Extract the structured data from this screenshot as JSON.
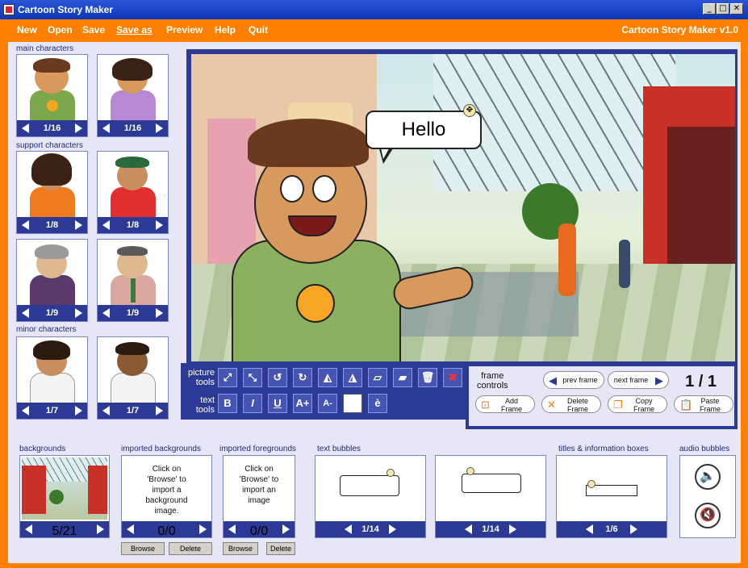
{
  "window": {
    "title": "Cartoon Story Maker"
  },
  "menu": {
    "items": [
      "New",
      "Open",
      "Save",
      "Save as",
      "Preview",
      "Help",
      "Quit"
    ],
    "active": "Save as",
    "version": "Cartoon Story Maker v1.0"
  },
  "characters": {
    "main_label": "main characters",
    "support_label": "support characters",
    "minor_label": "minor characters",
    "main": [
      {
        "count": "1/16"
      },
      {
        "count": "1/16"
      }
    ],
    "support": [
      {
        "count": "1/8"
      },
      {
        "count": "1/8"
      },
      {
        "count": "1/9"
      },
      {
        "count": "1/9"
      }
    ],
    "minor": [
      {
        "count": "1/7"
      },
      {
        "count": "1/7"
      }
    ]
  },
  "scene": {
    "speech_text": "Hello"
  },
  "tools": {
    "picture_label_1": "picture",
    "picture_label_2": "tools",
    "text_label_1": "text",
    "text_label_2": "tools",
    "bold": "B",
    "italic": "I",
    "underline": "U",
    "size_up": "A+",
    "size_down": "A-",
    "accent": "è"
  },
  "frame_controls": {
    "label_1": "frame",
    "label_2": "controls",
    "prev": "prev frame",
    "next": "next frame",
    "counter": "1 / 1",
    "add_1": "Add",
    "add_2": "Frame",
    "delete_1": "Delete",
    "delete_2": "Frame",
    "copy_1": "Copy",
    "copy_2": "Frame",
    "paste_1": "Paste",
    "paste_2": "Frame"
  },
  "bottom": {
    "backgrounds_label": "backgrounds",
    "backgrounds_count": "5/21",
    "imported_bg_label": "imported backgrounds",
    "imported_bg_text_1": "Click on",
    "imported_bg_text_2": "'Browse' to",
    "imported_bg_text_3": "import a",
    "imported_bg_text_4": "background",
    "imported_bg_text_5": "image.",
    "imported_bg_count": "0/0",
    "imported_fg_label": "imported foregrounds",
    "imported_fg_text_1": "Click on",
    "imported_fg_text_2": "'Browse' to",
    "imported_fg_text_3": "import an",
    "imported_fg_text_4": "image",
    "imported_fg_count": "0/0",
    "browse": "Browse",
    "delete": "Delete",
    "text_bubbles_label": "text bubbles",
    "bubble1_count": "1/14",
    "bubble2_count": "1/14",
    "titles_label": "titles & information boxes",
    "titles_count": "1/6",
    "audio_label": "audio bubbles"
  },
  "colors": {
    "accent_orange": "#ff7f00",
    "nav_blue": "#2d3a95",
    "panel": "#e6e6f7"
  }
}
